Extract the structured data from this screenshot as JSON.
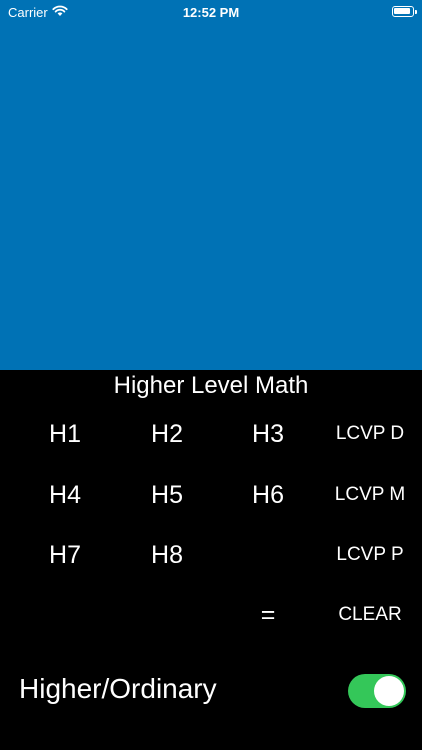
{
  "status_bar": {
    "carrier": "Carrier",
    "time": "12:52 PM",
    "battery_icon": "battery-full-icon",
    "wifi_icon": "wifi-icon"
  },
  "display": {
    "color": "#0072B5"
  },
  "keypad": {
    "title": "Higher Level Math",
    "keys": {
      "h1": "H1",
      "h2": "H2",
      "h3": "H3",
      "lcvp_d": "LCVP D",
      "h4": "H4",
      "h5": "H5",
      "h6": "H6",
      "lcvp_m": "LCVP M",
      "h7": "H7",
      "h8": "H8",
      "lcvp_p": "LCVP P",
      "equals": "=",
      "clear": "CLEAR"
    }
  },
  "level_toggle": {
    "label": "Higher/Ordinary",
    "on": true,
    "color": "#34C759"
  }
}
